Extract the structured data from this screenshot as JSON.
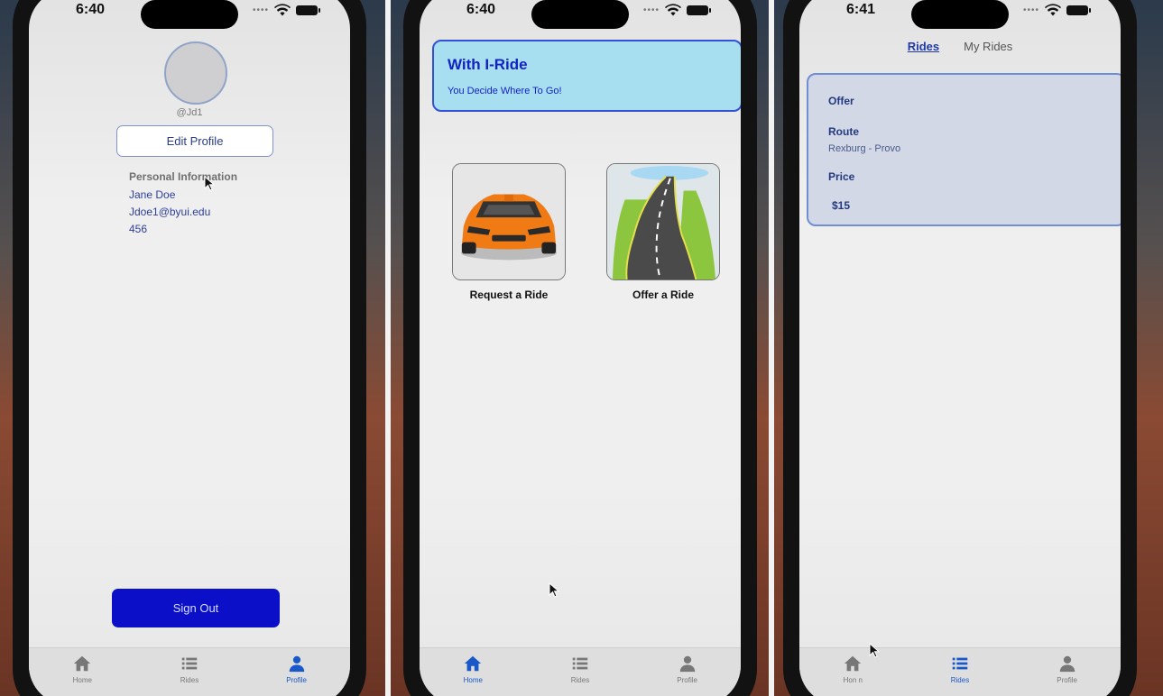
{
  "status": {
    "time1": "6:40",
    "time2": "6:40",
    "time3": "6:41"
  },
  "tabs": {
    "home": "Home",
    "rides": "Rides",
    "profile": "Profile",
    "home_obscured": "Hon n"
  },
  "profile": {
    "handle": "@Jd1",
    "edit_label": "Edit Profile",
    "section_title": "Personal Information",
    "name": "Jane Doe",
    "email": "Jdoe1@byui.edu",
    "id": "456",
    "signout_label": "Sign Out"
  },
  "home": {
    "banner_title": "With I-Ride",
    "banner_subtitle": "You Decide Where To Go!",
    "request_label": "Request a Ride",
    "offer_label": "Offer a Ride"
  },
  "rides": {
    "tab_rides": "Rides",
    "tab_my_rides": "My Rides",
    "card_type": "Offer",
    "route_label": "Route",
    "route_value": "Rexburg - Provo",
    "price_label": "Price",
    "price_value": "$15"
  },
  "colors": {
    "accent": "#1858c9",
    "signout": "#0b10c8",
    "banner_bg": "#a7dff1",
    "banner_text": "#1322c3"
  }
}
